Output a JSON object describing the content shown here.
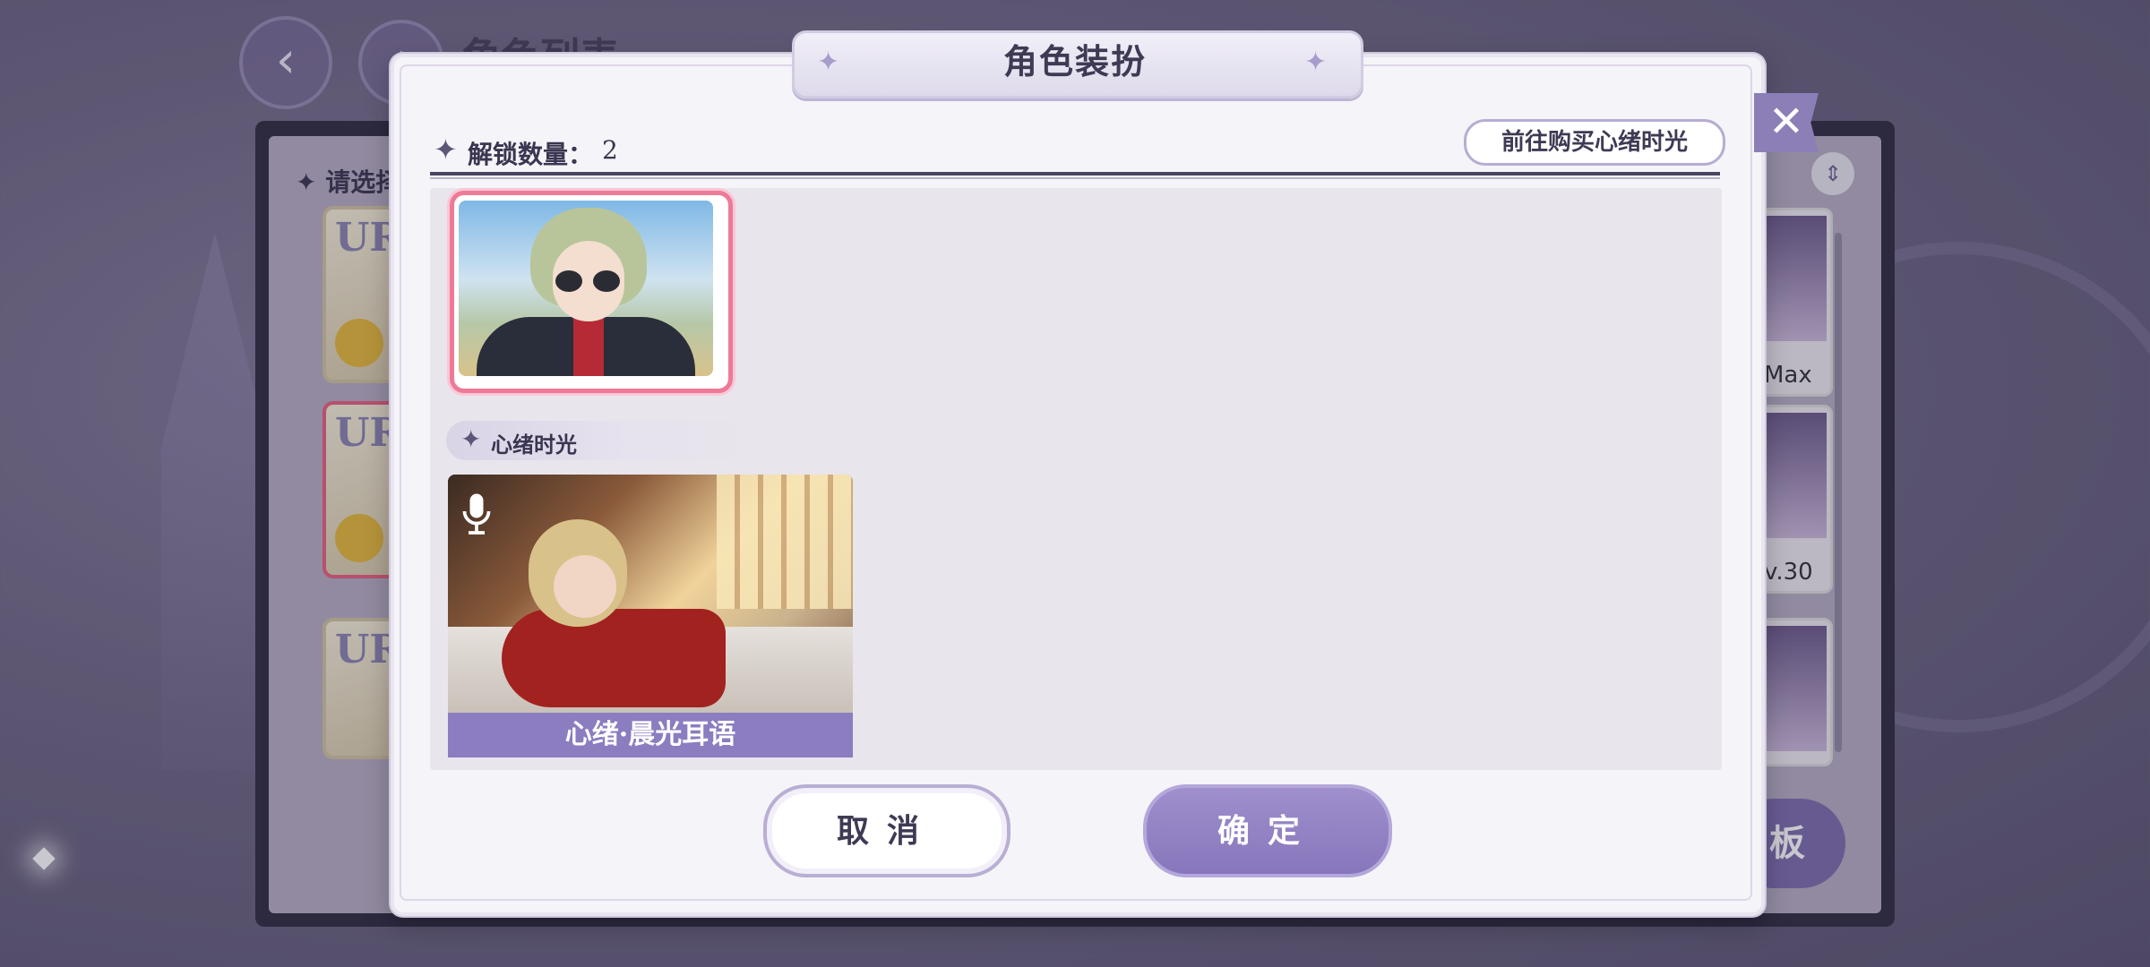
{
  "background": {
    "page_title": "角色列表",
    "select_label": "请选择",
    "back_icon": "back-arrow-icon",
    "home_icon": "home-icon",
    "left_cards": [
      {
        "badge": "UR",
        "icon": "book-icon",
        "selected": false
      },
      {
        "badge": "UR",
        "icon": "key-icon",
        "selected": true
      },
      {
        "badge": "UR",
        "icon": "book-icon",
        "selected": false
      }
    ],
    "right_cards": [
      {
        "label": "Max"
      },
      {
        "label": "v.30"
      },
      {
        "label": ""
      }
    ],
    "right_button_label": "板"
  },
  "dialog": {
    "title": "角色装扮",
    "close_icon": "close-icon",
    "unlock_label": "解锁数量：",
    "unlock_count": "2",
    "buy_button_label": "前往购买心绪时光",
    "section_label": "心绪时光",
    "mood_card": {
      "label": "心绪·晨光耳语",
      "icon": "microphone-icon"
    },
    "cancel_label": "取消",
    "confirm_label": "确定"
  },
  "colors": {
    "accent_purple": "#8c7cc0",
    "selected_pink": "#ef7a97",
    "dialog_bg": "#f5f4f8"
  }
}
